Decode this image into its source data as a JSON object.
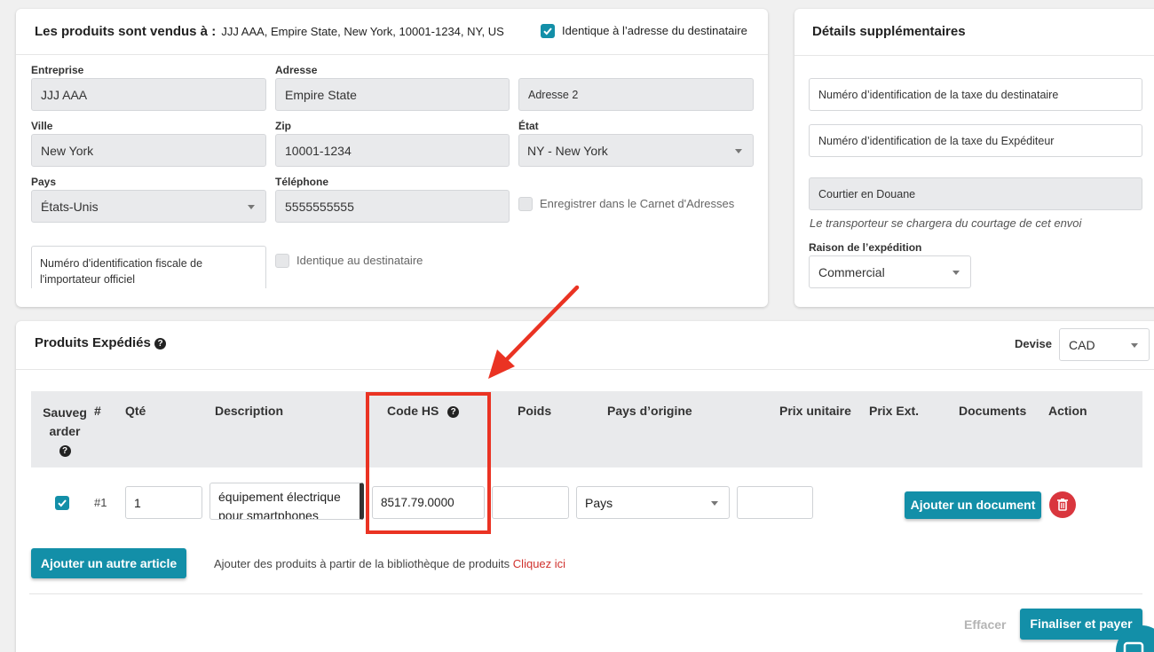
{
  "sold_to": {
    "title": "Les produits sont vendus à :",
    "address_summary": "JJJ AAA, Empire State, New York, 10001-1234, NY, US",
    "same_as_recipient_label": "Identique à l’adresse du destinataire",
    "company_label": "Entreprise",
    "company_value": "JJJ AAA",
    "address_label": "Adresse",
    "address_value": "Empire State",
    "address2_placeholder": "Adresse 2",
    "city_label": "Ville",
    "city_value": "New York",
    "zip_label": "Zip",
    "zip_value": "10001-1234",
    "state_label": "État",
    "state_value": "NY - New York",
    "country_label": "Pays",
    "country_value": "États-Unis",
    "phone_label": "Téléphone",
    "phone_value": "5555555555",
    "save_address_book_label": "Enregistrer dans le Carnet d'Adresses",
    "importer_tax_id_placeholder": "Numéro d'identification fiscale de l'importateur officiel",
    "identical_recipient_label": "Identique au destinataire"
  },
  "details": {
    "title": "Détails supplémentaires",
    "recipient_tax_id_placeholder": "Numéro d’identification de la taxe du destinataire",
    "shipper_tax_id_placeholder": "Numéro d’identification de la taxe du Expéditeur",
    "customs_broker_value": "Courtier en Douane",
    "broker_note": "Le transporteur se chargera du courtage de cet envoi",
    "reason_label": "Raison de l’expédition",
    "reason_value": "Commercial"
  },
  "products": {
    "title": "Produits Expédiés",
    "currency_label": "Devise",
    "currency_value": "CAD",
    "columns": {
      "save_line1": "Sauveg",
      "save_line2": "arder",
      "num": "#",
      "qty": "Qté",
      "description": "Description",
      "hs_code": "Code HS",
      "weight": "Poids",
      "origin": "Pays d’origine",
      "unit_price": "Prix unitaire",
      "ext_price": "Prix Ext.",
      "documents": "Documents",
      "action": "Action"
    },
    "rows": [
      {
        "num": "#1",
        "qty": "1",
        "description_line1": "équipement électrique",
        "description_line2": "pour smartphones",
        "hs_code": "8517.79.0000",
        "weight": "",
        "origin": "Pays",
        "unit_price": "",
        "add_document_label": "Ajouter un document"
      }
    ],
    "add_item_label": "Ajouter un autre article",
    "library_text": "Ajouter des produits à partir de la bibliothèque de produits",
    "library_link": "Cliquez ici",
    "clear_label": "Effacer",
    "finalize_label": "Finaliser et payer"
  },
  "colors": {
    "accent": "#138fa8",
    "highlight_red": "#ea3323",
    "delete_red": "#d9363e",
    "link_red": "#d0312d"
  }
}
